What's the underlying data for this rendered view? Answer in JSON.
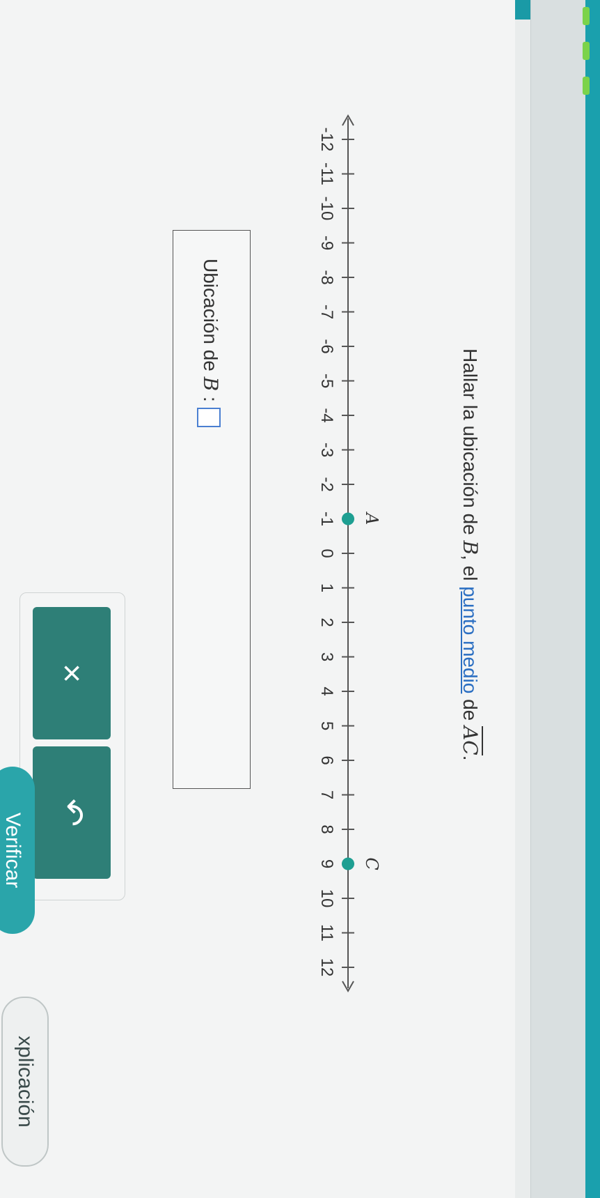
{
  "prompt": {
    "text_before": "Hallar la ubicación de ",
    "var_b": "B",
    "text_middle": ", el ",
    "link": "punto medio",
    "text_after": " de ",
    "segment": "AC",
    "end": "."
  },
  "number_line": {
    "min": -12,
    "max": 12,
    "tick_labels": [
      "-12",
      "-11",
      "-10",
      "-9",
      "-8",
      "-7",
      "-6",
      "-5",
      "-4",
      "-3",
      "-2",
      "-1",
      "0",
      "1",
      "2",
      "3",
      "4",
      "5",
      "6",
      "7",
      "8",
      "9",
      "10",
      "11",
      "12"
    ],
    "points": [
      {
        "label": "A",
        "value": -1
      },
      {
        "label": "C",
        "value": 9
      }
    ],
    "point_color": "#1e9f92"
  },
  "answer": {
    "label_prefix": "Ubicación de ",
    "var": "B",
    "colon": " :",
    "value": ""
  },
  "tools": {
    "clear_icon": "×",
    "undo_icon": "↶"
  },
  "buttons": {
    "explicacion": "xplicación",
    "verificar": "Verificar"
  }
}
